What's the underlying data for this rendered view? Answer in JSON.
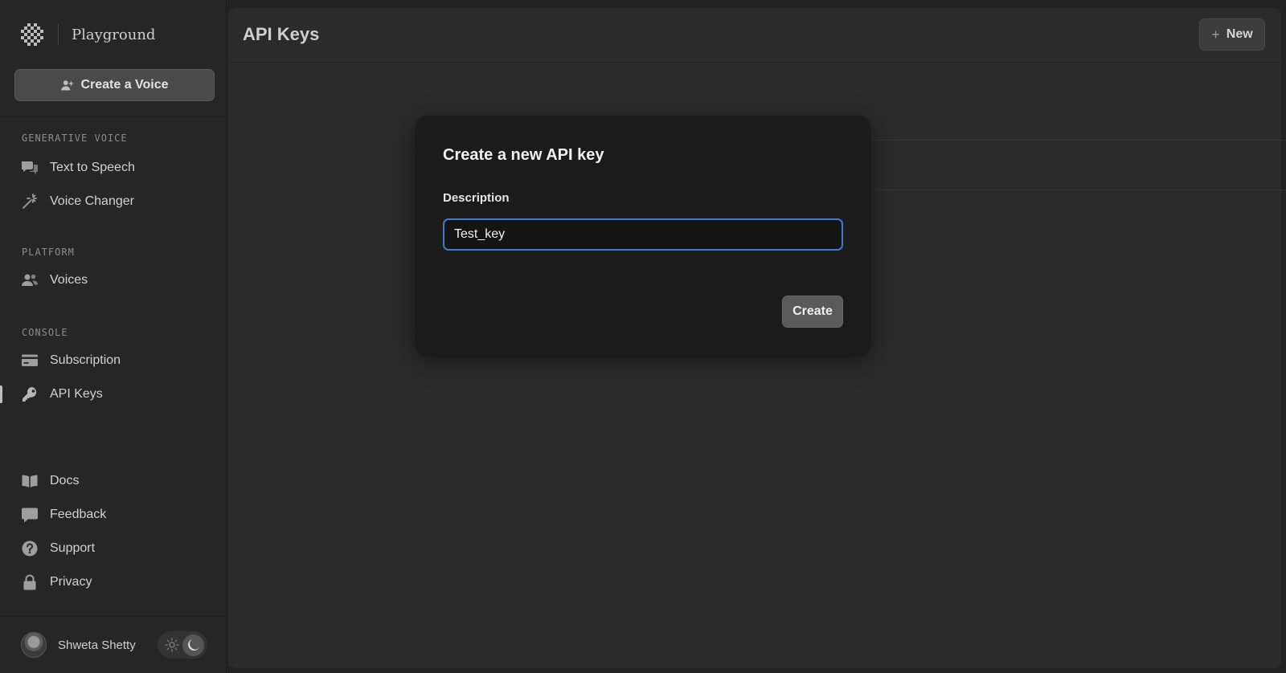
{
  "sidebar": {
    "brand": {
      "name": "Playground",
      "logo_icon": "checker-logo-icon"
    },
    "create_voice_label": "Create a Voice",
    "sections": {
      "generative_voice": "GENERATIVE VOICE",
      "platform": "PLATFORM",
      "console": "CONSOLE"
    },
    "items": [
      {
        "label": "Text to Speech",
        "icon": "speech-bubbles-icon"
      },
      {
        "label": "Voice Changer",
        "icon": "magic-wand-icon"
      },
      {
        "label": "Voices",
        "icon": "users-icon"
      },
      {
        "label": "Subscription",
        "icon": "credit-card-icon"
      },
      {
        "label": "API Keys",
        "icon": "key-icon",
        "active": true
      },
      {
        "label": "Docs",
        "icon": "book-icon"
      },
      {
        "label": "Feedback",
        "icon": "chat-bubble-icon"
      },
      {
        "label": "Support",
        "icon": "question-icon"
      },
      {
        "label": "Privacy",
        "icon": "lock-icon"
      }
    ],
    "user": {
      "name": "Shweta Shetty"
    },
    "theme": {
      "mode": "dark"
    }
  },
  "header": {
    "title": "API Keys",
    "new_label": "New"
  },
  "modal": {
    "title": "Create a new API key",
    "description_label": "Description",
    "description_value": "Test_key",
    "create_label": "Create"
  },
  "colors": {
    "focus_ring": "#3f79d6",
    "background": "#2b2b2b",
    "sidebar": "#262626",
    "modal": "#1b1b1b"
  }
}
